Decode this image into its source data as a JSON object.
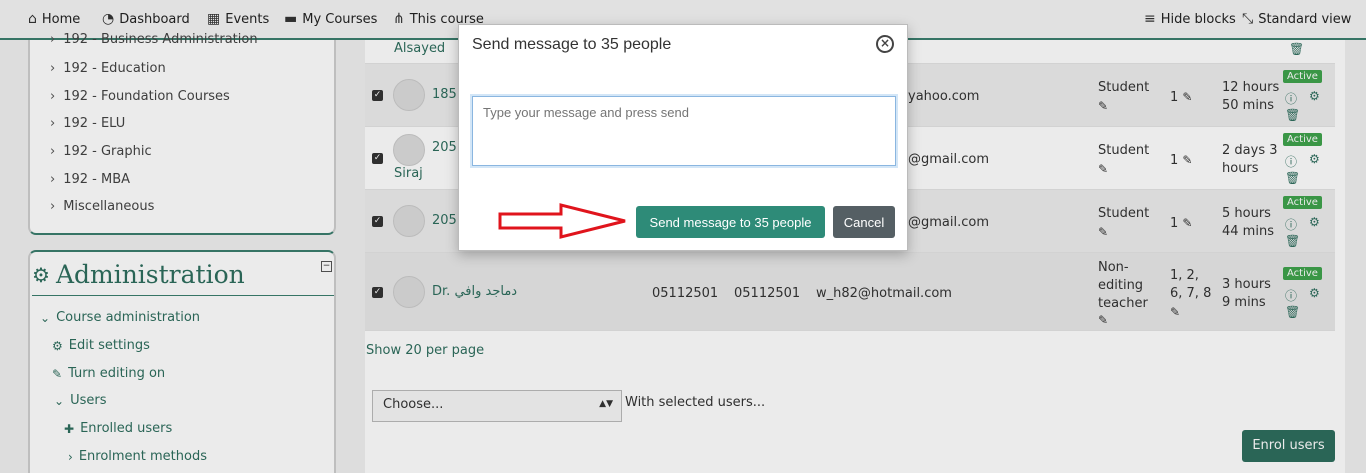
{
  "topnav": {
    "home": "Home",
    "dashboard": "Dashboard",
    "events": "Events",
    "my_courses": "My Courses",
    "this_course": "This course",
    "hide_blocks": "Hide blocks",
    "standard_view": "Standard view"
  },
  "categories": [
    "192 - Business Administration",
    "192 - Education",
    "192 - Foundation Courses",
    "192 - ELU",
    "192 - Graphic",
    "192 - MBA",
    "Miscellaneous"
  ],
  "admin": {
    "title": "Administration",
    "course_admin": "Course administration",
    "edit_settings": "Edit settings",
    "turn_editing": "Turn editing on",
    "users": "Users",
    "enrolled_users": "Enrolled users",
    "enrolment_methods": "Enrolment methods"
  },
  "table": {
    "rows": [
      {
        "name": "Alsayed",
        "id1": "",
        "id2": "",
        "email": "",
        "role": "",
        "groups": "",
        "last_access": "",
        "status": ""
      },
      {
        "name": "185",
        "id1": "",
        "id2": "",
        "email": "yahoo.com",
        "role": "Student",
        "groups": "1",
        "last_access": "12 hours 50 mins",
        "status": "Active"
      },
      {
        "name": "205",
        "name2": "Siraj",
        "id1": "",
        "id2": "",
        "email": "@gmail.com",
        "role": "Student",
        "groups": "1",
        "last_access": "2 days 3 hours",
        "status": "Active"
      },
      {
        "name": "205",
        "id1": "",
        "id2": "",
        "email": "@gmail.com",
        "role": "Student",
        "groups": "1",
        "last_access": "5 hours 44 mins",
        "status": "Active"
      },
      {
        "name": "Dr. دماجد وافي",
        "id1": "05112501",
        "id2": "05112501",
        "email": "w_h82@hotmail.com",
        "role": "Non-editing teacher",
        "groups": "1, 2, 6, 7, 8",
        "last_access": "3 hours 9 mins",
        "status": "Active"
      }
    ],
    "per_page": "Show 20 per page",
    "select_value": "Choose...",
    "with_selected": "With selected users...",
    "enrol_button": "Enrol users"
  },
  "modal": {
    "title": "Send message to 35 people",
    "placeholder": "Type your message and press send",
    "send_label": "Send message to 35 people",
    "cancel_label": "Cancel"
  },
  "colors": {
    "brand": "#2e6e5e",
    "send_button": "#2e8b78",
    "cancel_button": "#555f64",
    "active_badge": "#3fa34d",
    "annotation_arrow": "#e0141c"
  }
}
